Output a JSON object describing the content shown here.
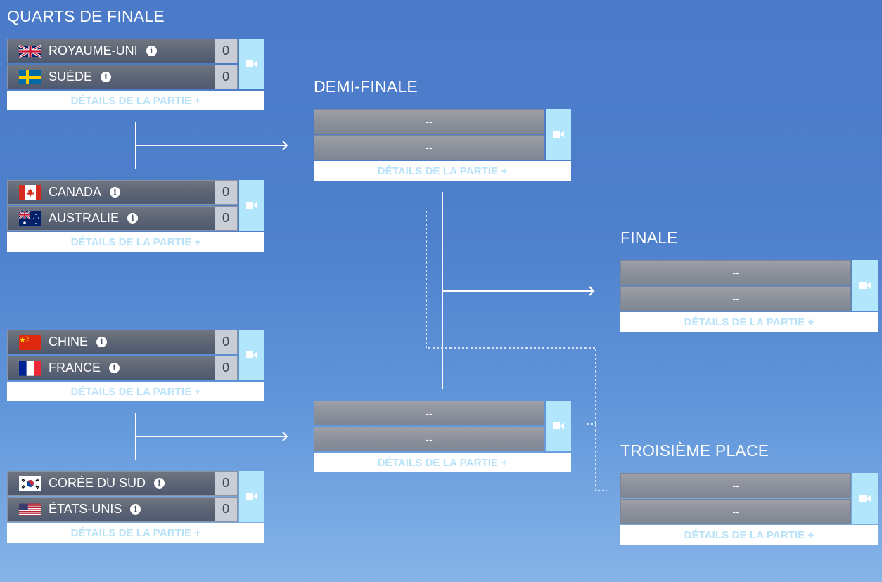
{
  "rounds": {
    "quarterfinals": {
      "title": "QUARTS DE FINALE",
      "matches": [
        {
          "teams": [
            {
              "name": "ROYAUME-UNI",
              "flag": "uk-flag",
              "score": "0"
            },
            {
              "name": "SUÈDE",
              "flag": "sweden-flag",
              "score": "0"
            }
          ],
          "details_label": "DÉTAILS DE LA PARTIE +"
        },
        {
          "teams": [
            {
              "name": "CANADA",
              "flag": "canada-flag",
              "score": "0"
            },
            {
              "name": "AUSTRALIE",
              "flag": "australia-flag",
              "score": "0"
            }
          ],
          "details_label": "DÉTAILS DE LA PARTIE +"
        },
        {
          "teams": [
            {
              "name": "CHINE",
              "flag": "china-flag",
              "score": "0"
            },
            {
              "name": "FRANCE",
              "flag": "france-flag",
              "score": "0"
            }
          ],
          "details_label": "DÉTAILS DE LA PARTIE +"
        },
        {
          "teams": [
            {
              "name": "CORÉE DU SUD",
              "flag": "south-korea-flag",
              "score": "0"
            },
            {
              "name": "ÉTATS-UNIS",
              "flag": "usa-flag",
              "score": "0"
            }
          ],
          "details_label": "DÉTAILS DE LA PARTIE +"
        }
      ]
    },
    "semifinal": {
      "title": "DEMI-FINALE",
      "matches": [
        {
          "teams": [
            {
              "name": "--"
            },
            {
              "name": "--"
            }
          ],
          "details_label": "DÉTAILS DE LA PARTIE +"
        },
        {
          "teams": [
            {
              "name": "--"
            },
            {
              "name": "--"
            }
          ],
          "details_label": "DÉTAILS DE LA PARTIE +"
        }
      ]
    },
    "final": {
      "title": "FINALE",
      "matches": [
        {
          "teams": [
            {
              "name": "--"
            },
            {
              "name": "--"
            }
          ],
          "details_label": "DÉTAILS DE LA PARTIE +"
        }
      ]
    },
    "third_place": {
      "title": "TROISIÈME PLACE",
      "matches": [
        {
          "teams": [
            {
              "name": "--"
            },
            {
              "name": "--"
            }
          ],
          "details_label": "DÉTAILS DE LA PARTIE +"
        }
      ]
    }
  },
  "icons": {
    "info": "info-icon",
    "video": "video-camera-icon",
    "info_glyph": "i"
  },
  "colors": {
    "camera_button": "#b2e6fd",
    "details_text": "#b8e2f8",
    "score_bg": "#c9ced6"
  }
}
